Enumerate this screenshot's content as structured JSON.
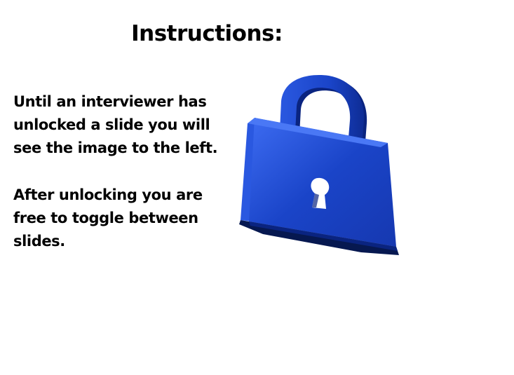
{
  "slide": {
    "title": "Instructions:",
    "paragraph_1": "Until an interviewer has unlocked a slide you will see the image to the left.",
    "paragraph_2": "After unlocking you are free to toggle between slides."
  },
  "image": {
    "icon": "padlock-icon",
    "colors": {
      "body": "#1a44c8",
      "highlight": "#3a6af0",
      "shadow": "#0a2480",
      "dark_edge": "#061850"
    }
  }
}
